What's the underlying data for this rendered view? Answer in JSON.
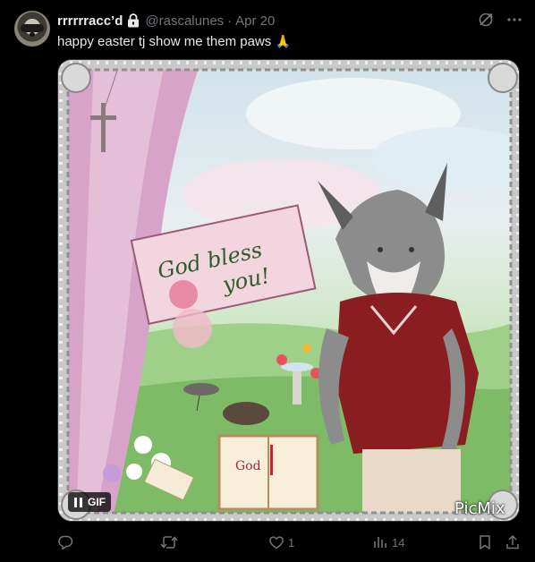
{
  "post": {
    "display_name": "rrrrrracc’d",
    "handle": "@rascalunes",
    "separator": "·",
    "date": "Apr 20",
    "text": "happy easter tj show me them paws",
    "emoji": "🙏"
  },
  "icons": {
    "lock": "lock-icon",
    "grok": "grok-icon",
    "more": "more-icon",
    "reply": "reply-icon",
    "repost": "repost-icon",
    "like": "heart-icon",
    "views": "views-icon",
    "bookmark": "bookmark-icon",
    "share": "share-icon"
  },
  "media": {
    "badge": "GIF",
    "sign_text_line1": "God bless",
    "sign_text_line2": "you!",
    "book_text": "God",
    "watermark": "PicMix"
  },
  "actions": {
    "reply_count": "",
    "repost_count": "",
    "like_count": "1",
    "views_count": "14"
  },
  "colors": {
    "background": "#000000",
    "text": "#e7e9ea",
    "muted": "#71767b"
  }
}
